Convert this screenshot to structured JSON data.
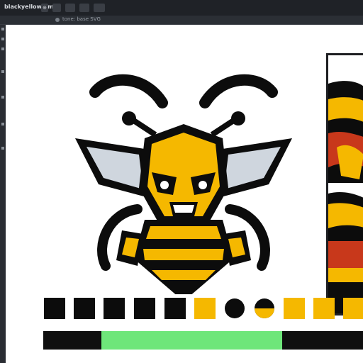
{
  "app": {
    "title": "blackyellow.bmd"
  },
  "titlebar": {
    "buttons": [
      "⊕",
      "",
      "",
      "",
      ""
    ]
  },
  "toolbar": {
    "label": "tone: base SVG"
  },
  "swatches": [
    {
      "color": "#0c0c0c"
    },
    {
      "color": "#0c0c0c"
    },
    {
      "color": "#0c0c0c"
    },
    {
      "color": "#0c0c0c"
    },
    {
      "color": "#0c0c0c"
    },
    {
      "color": "#f5b800"
    },
    {
      "color": "#0c0c0c",
      "shape": "circle"
    },
    {
      "color": "#f5b800",
      "shape": "half-circle"
    },
    {
      "color": "#f5b800"
    },
    {
      "color": "#f5b800"
    },
    {
      "color": "#f5b800"
    }
  ],
  "progress": {
    "value_fraction": 0.55,
    "fill_color": "#6ee67a"
  },
  "colors": {
    "black": "#0c0c0c",
    "yellow": "#f5b800",
    "red": "#c8381b",
    "wing": "#cfd6de"
  }
}
